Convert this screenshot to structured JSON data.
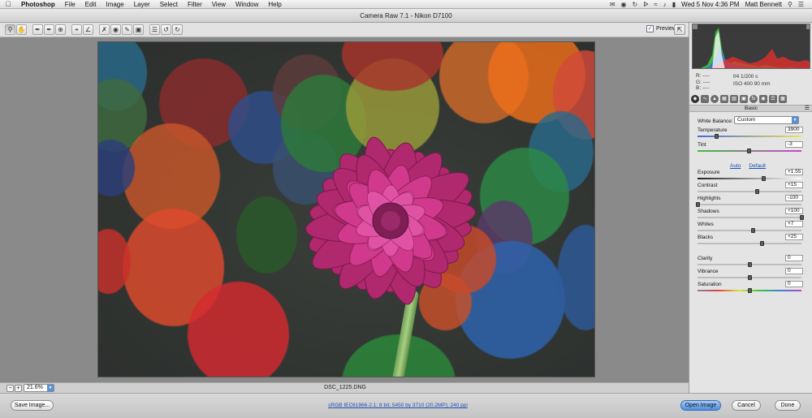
{
  "menubar": {
    "app": "Photoshop",
    "items": [
      "File",
      "Edit",
      "Image",
      "Layer",
      "Select",
      "Filter",
      "View",
      "Window",
      "Help"
    ],
    "clock": "Wed 5 Nov  4:36 PM",
    "user": "Matt Bennett"
  },
  "window": {
    "title": "Camera Raw 7.1  -  Nikon D7100"
  },
  "toolbar": {
    "preview_label": "Preview",
    "preview_checked": true
  },
  "canvas": {
    "zoom": "21.6%",
    "filename": "DSC_1225.DNG"
  },
  "histogram": {
    "r_label": "R:",
    "g_label": "G:",
    "b_label": "B:",
    "r_value": "----",
    "g_value": "----",
    "b_value": "----",
    "aperture_shutter": "f/4   1/200 s",
    "iso_focal": "ISO 400   90 mm"
  },
  "panel": {
    "section_title": "Basic",
    "white_balance_label": "White Balance:",
    "white_balance_value": "Custom",
    "auto_label": "Auto",
    "default_label": "Default",
    "sliders": [
      {
        "label": "Temperature",
        "value": "3900",
        "fraction": 0.18
      },
      {
        "label": "Tint",
        "value": "-3",
        "fraction": 0.49
      },
      {
        "label": "Exposure",
        "value": "+1.55",
        "fraction": 0.63
      },
      {
        "label": "Contrast",
        "value": "+15",
        "fraction": 0.57
      },
      {
        "label": "Highlights",
        "value": "-100",
        "fraction": 0.0
      },
      {
        "label": "Shadows",
        "value": "+100",
        "fraction": 1.0
      },
      {
        "label": "Whites",
        "value": "+7",
        "fraction": 0.53
      },
      {
        "label": "Blacks",
        "value": "+25",
        "fraction": 0.62
      },
      {
        "label": "Clarity",
        "value": "0",
        "fraction": 0.5
      },
      {
        "label": "Vibrance",
        "value": "0",
        "fraction": 0.5
      },
      {
        "label": "Saturation",
        "value": "0",
        "fraction": 0.5
      }
    ]
  },
  "bottom": {
    "save_label": "Save Image...",
    "workflow_options": "sRGB IEC61966-2.1; 8 bit; 5450 by 3710 (20.2MP); 240 ppi",
    "open_label": "Open Image",
    "cancel_label": "Cancel",
    "done_label": "Done"
  },
  "colors": {
    "accent": "#4b8ee2",
    "flower": "#c8307f"
  }
}
